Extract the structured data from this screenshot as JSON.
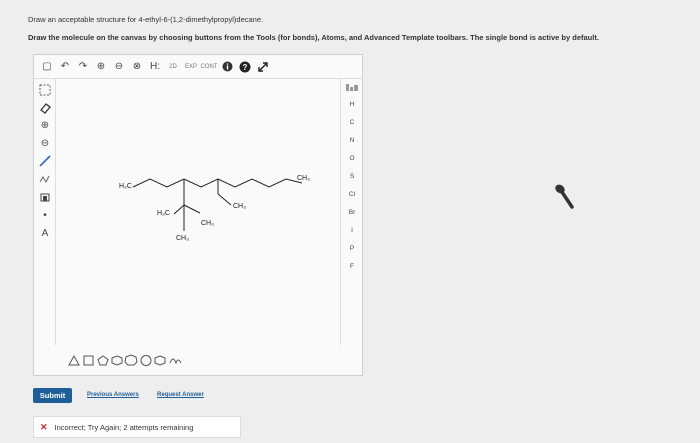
{
  "prompt": "Draw an acceptable structure for 4-ethyl-6-(1,2-dimethylpropyl)decane.",
  "instructions": "Draw the molecule on the canvas by choosing buttons from the Tools (for bonds), Atoms, and Advanced Template toolbars. The single bond is active by default.",
  "toolbar": {
    "tools_top": [
      {
        "name": "new-document-icon",
        "glyph": "▢"
      },
      {
        "name": "undo-icon",
        "glyph": "↶"
      },
      {
        "name": "redo-icon",
        "glyph": "↷"
      },
      {
        "name": "zoom-in-icon",
        "glyph": "⊕"
      },
      {
        "name": "zoom-out-icon",
        "glyph": "⊖"
      },
      {
        "name": "zoom-reset-icon",
        "glyph": "⊗"
      },
      {
        "name": "hydrogen-toggle-icon",
        "glyph": "H:"
      },
      {
        "name": "2d-clean-icon",
        "glyph": "2D"
      },
      {
        "name": "exp-icon",
        "glyph": "EXP"
      },
      {
        "name": "cont-icon",
        "glyph": "CONT"
      },
      {
        "name": "info-icon",
        "glyph": "●"
      },
      {
        "name": "help-icon",
        "glyph": "?"
      },
      {
        "name": "fullscreen-icon",
        "glyph": "↗"
      }
    ],
    "tools_left": [
      {
        "name": "select-tool-icon",
        "glyph": "⬚"
      },
      {
        "name": "eraser-icon",
        "glyph": "◇"
      },
      {
        "name": "positive-charge-icon",
        "glyph": "⊕"
      },
      {
        "name": "negative-charge-icon",
        "glyph": "⊖"
      },
      {
        "name": "single-bond-icon",
        "glyph": "╱"
      },
      {
        "name": "chain-tool-icon",
        "glyph": "⌇"
      },
      {
        "name": "template-tool-icon",
        "glyph": "⌂"
      },
      {
        "name": "radical-icon",
        "glyph": "•"
      },
      {
        "name": "atom-label-icon",
        "glyph": "A"
      }
    ],
    "atoms": [
      "H",
      "C",
      "N",
      "O",
      "S",
      "Cl",
      "Br",
      "I",
      "P",
      "F"
    ],
    "periodic_table_icon": "periodic-table-icon",
    "templates": [
      {
        "name": "cyclopropane-icon",
        "glyph": "△"
      },
      {
        "name": "cyclobutane-icon",
        "glyph": "□"
      },
      {
        "name": "cyclopentane-icon",
        "glyph": "⬠"
      },
      {
        "name": "cyclohexane-icon",
        "glyph": "⬡"
      },
      {
        "name": "cycloheptane-icon",
        "glyph": "⬡"
      },
      {
        "name": "cyclooctane-icon",
        "glyph": "⯃"
      },
      {
        "name": "benzene-icon",
        "glyph": "⬡"
      },
      {
        "name": "template-library-icon",
        "glyph": "⌬"
      }
    ]
  },
  "molecule_labels": {
    "ch3_left": "H₃C",
    "ch3_right": "CH₃",
    "ch3_branch_left": "H₃C",
    "ch3_branch_mid": "CH₃",
    "ch3_branch_right": "CH₃",
    "ch3_bottom": "CH₃"
  },
  "buttons": {
    "submit": "Submit",
    "previous_answers": "Previous Answers",
    "request_answer": "Request Answer"
  },
  "feedback": {
    "status": "Incorrect; Try Again; 2 attempts remaining"
  },
  "colors": {
    "submit_bg": "#1f5f99",
    "error": "#c62828",
    "link": "#1f5f99"
  }
}
